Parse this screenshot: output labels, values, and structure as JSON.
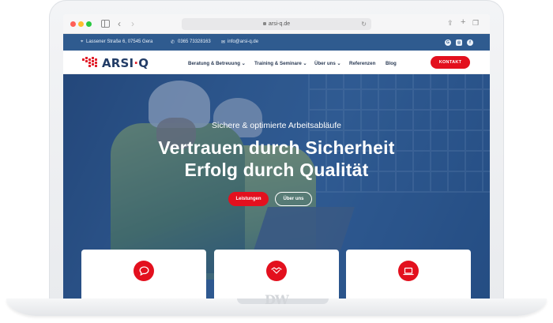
{
  "browser": {
    "url": "arsi-q.de"
  },
  "infobar": {
    "address": "Lassener Straße 6, 07545 Gera",
    "phone": "0365 73328163",
    "email": "info@arsi-q.de",
    "social_icons": [
      "google-icon",
      "instagram-icon",
      "facebook-icon"
    ]
  },
  "header": {
    "logo_text": "ARSI",
    "logo_sep": "·",
    "logo_suffix": "Q",
    "nav": [
      {
        "label": "Beratung & Betreuung ⌄"
      },
      {
        "label": "Training & Seminare ⌄"
      },
      {
        "label": "Über uns ⌄"
      },
      {
        "label": "Referenzen"
      },
      {
        "label": "Blog"
      }
    ],
    "cta": "KONTAKT"
  },
  "hero": {
    "kicker": "Sichere & optimierte Arbeitsabläufe",
    "title_line1": "Vertrauen durch Sicherheit",
    "title_line2": "Erfolg durch Qualität",
    "primary_button": "Leistungen",
    "secondary_button": "Über uns"
  },
  "cards": [
    {
      "icon": "chat-bubble-icon"
    },
    {
      "icon": "handshake-icon"
    },
    {
      "icon": "laptop-icon"
    }
  ],
  "colors": {
    "accent_red": "#e3101e",
    "brand_blue": "#2f5b8f",
    "logo_blue": "#223c66"
  },
  "watermark": "DW"
}
